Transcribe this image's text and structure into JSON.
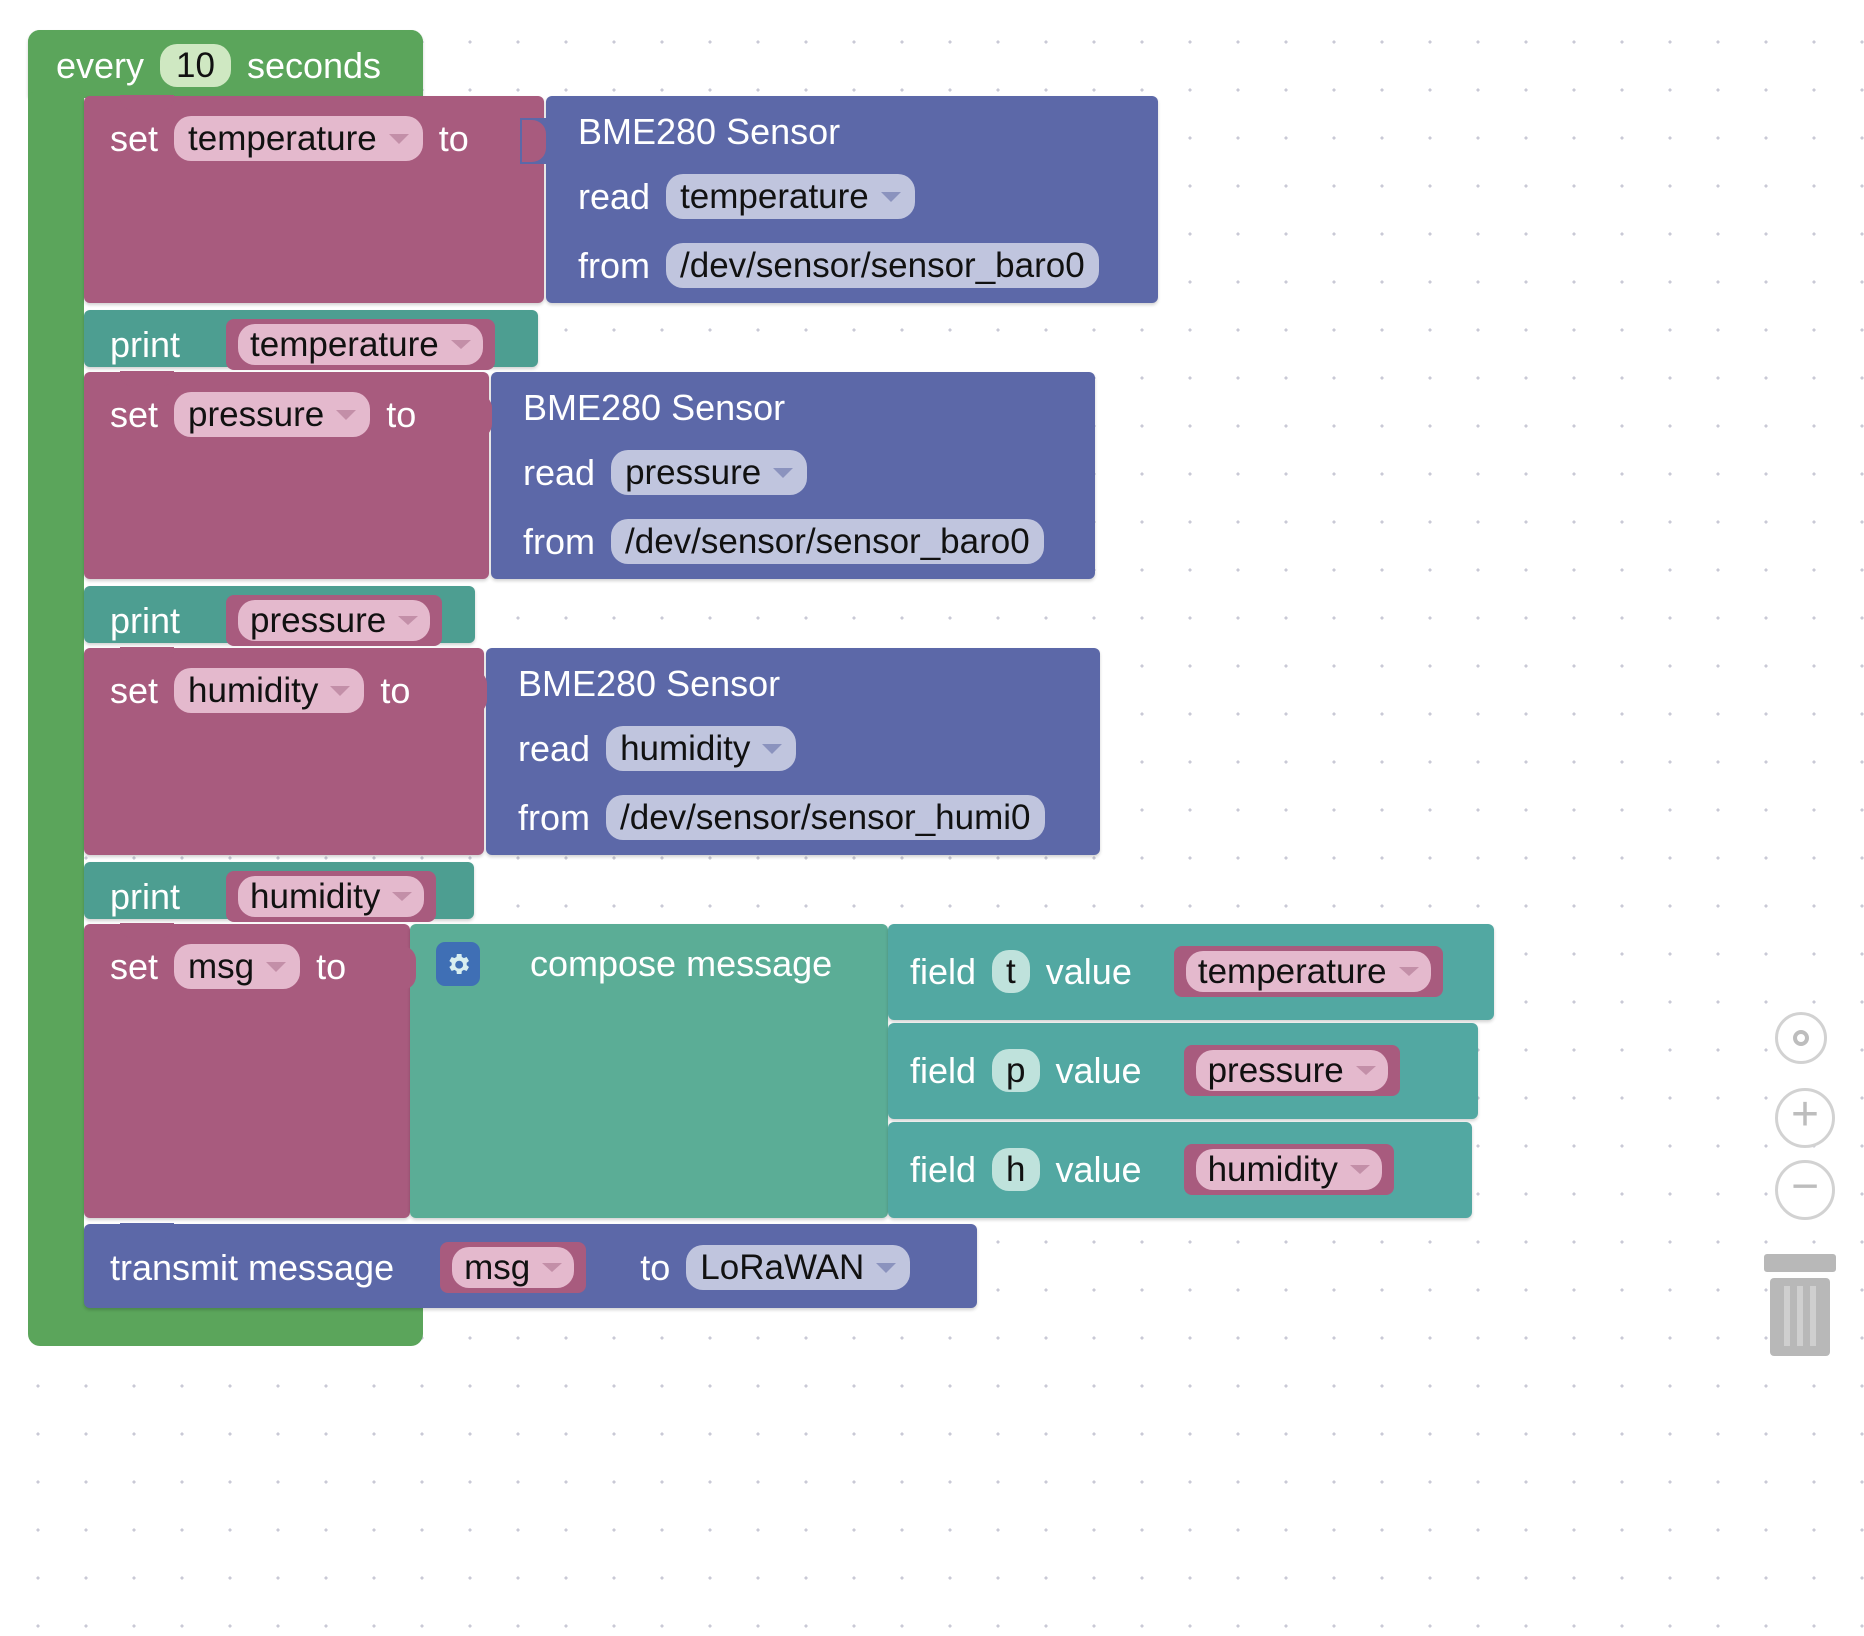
{
  "workspace": {
    "title": "Blockly visual program workspace",
    "colors": {
      "event_green": "#5ba55b",
      "variable_mauve": "#a85b7e",
      "sensor_blue": "#5c68a8",
      "print_teal": "#4d9e91",
      "compose_sea": "#5bad96",
      "field_teal": "#52a8a2"
    }
  },
  "event_block": {
    "label_before": "every",
    "interval": "10",
    "label_after": "seconds"
  },
  "statements": [
    {
      "type": "set_variable",
      "set_label": "set",
      "variable": "temperature",
      "to_label": "to",
      "value_block": {
        "type": "sensor_read",
        "title": "BME280 Sensor",
        "read_label": "read",
        "measurement": "temperature",
        "from_label": "from",
        "device": "/dev/sensor/sensor_baro0"
      }
    },
    {
      "type": "print",
      "print_label": "print",
      "variable": "temperature"
    },
    {
      "type": "set_variable",
      "set_label": "set",
      "variable": "pressure",
      "to_label": "to",
      "value_block": {
        "type": "sensor_read",
        "title": "BME280 Sensor",
        "read_label": "read",
        "measurement": "pressure",
        "from_label": "from",
        "device": "/dev/sensor/sensor_baro0"
      }
    },
    {
      "type": "print",
      "print_label": "print",
      "variable": "pressure"
    },
    {
      "type": "set_variable",
      "set_label": "set",
      "variable": "humidity",
      "to_label": "to",
      "value_block": {
        "type": "sensor_read",
        "title": "BME280 Sensor",
        "read_label": "read",
        "measurement": "humidity",
        "from_label": "from",
        "device": "/dev/sensor/sensor_humi0"
      }
    },
    {
      "type": "print",
      "print_label": "print",
      "variable": "humidity"
    },
    {
      "type": "set_variable",
      "set_label": "set",
      "variable": "msg",
      "to_label": "to",
      "value_block": {
        "type": "compose_message",
        "gear_icon": "gear-icon",
        "title": "compose message",
        "fields": [
          {
            "field_label": "field",
            "key": "t",
            "value_label": "value",
            "variable": "temperature"
          },
          {
            "field_label": "field",
            "key": "p",
            "value_label": "value",
            "variable": "pressure"
          },
          {
            "field_label": "field",
            "key": "h",
            "value_label": "value",
            "variable": "humidity"
          }
        ]
      }
    },
    {
      "type": "transmit",
      "transmit_label": "transmit message",
      "message_variable": "msg",
      "to_label": "to",
      "destination": "LoRaWAN"
    }
  ],
  "controls": {
    "center_icon": "target-center-icon",
    "zoom_in": "+",
    "zoom_out": "−",
    "trash_icon": "trash-icon"
  }
}
